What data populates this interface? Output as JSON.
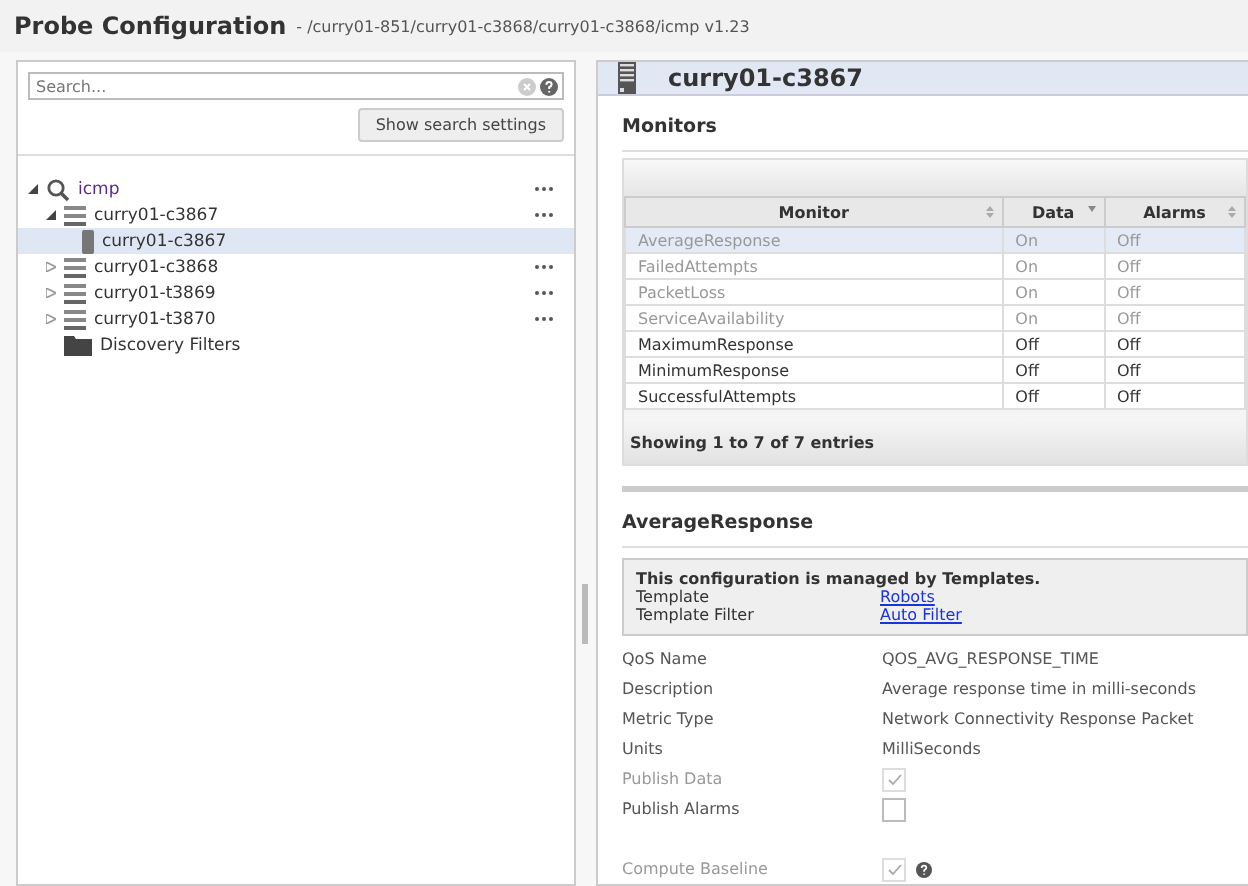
{
  "header": {
    "title": "Probe Configuration",
    "path": "- /curry01-851/curry01-c3868/curry01-c3868/icmp v1.23"
  },
  "search": {
    "placeholder": "Search...",
    "settings_button": "Show search settings"
  },
  "tree": [
    {
      "label": "icmp",
      "kind": "probe",
      "expanded": true,
      "selected": false,
      "menu": true,
      "children": [
        {
          "label": "curry01-c3867",
          "kind": "group",
          "expanded": true,
          "selected": false,
          "menu": true,
          "children": [
            {
              "label": "curry01-c3867",
              "kind": "device",
              "selected": true,
              "menu": false
            }
          ]
        },
        {
          "label": "curry01-c3868",
          "kind": "group",
          "expanded": false,
          "selected": false,
          "menu": true
        },
        {
          "label": "curry01-t3869",
          "kind": "group",
          "expanded": false,
          "selected": false,
          "menu": true
        },
        {
          "label": "curry01-t3870",
          "kind": "group",
          "expanded": false,
          "selected": false,
          "menu": true
        },
        {
          "label": "Discovery Filters",
          "kind": "folder",
          "selected": false,
          "menu": false
        }
      ]
    }
  ],
  "detail": {
    "title": "curry01-c3867",
    "section": "Monitors",
    "table": {
      "columns": [
        {
          "label": "Monitor",
          "sorted": false
        },
        {
          "label": "Data",
          "sorted": true
        },
        {
          "label": "Alarms",
          "sorted": false
        }
      ],
      "rows": [
        {
          "cells": [
            "AverageResponse",
            "On",
            "Off"
          ],
          "selected": true,
          "disabled": true
        },
        {
          "cells": [
            "FailedAttempts",
            "On",
            "Off"
          ],
          "selected": false,
          "disabled": true
        },
        {
          "cells": [
            "PacketLoss",
            "On",
            "Off"
          ],
          "selected": false,
          "disabled": true
        },
        {
          "cells": [
            "ServiceAvailability",
            "On",
            "Off"
          ],
          "selected": false,
          "disabled": true
        },
        {
          "cells": [
            "MaximumResponse",
            "Off",
            "Off"
          ],
          "selected": false,
          "disabled": false
        },
        {
          "cells": [
            "MinimumResponse",
            "Off",
            "Off"
          ],
          "selected": false,
          "disabled": false
        },
        {
          "cells": [
            "SuccessfulAttempts",
            "Off",
            "Off"
          ],
          "selected": false,
          "disabled": false
        }
      ],
      "footer": "Showing 1 to 7 of 7 entries"
    },
    "monitor_title": "AverageResponse",
    "template_box": {
      "heading": "This configuration is managed by Templates.",
      "rows": [
        {
          "label": "Template",
          "link": "Robots"
        },
        {
          "label": "Template Filter",
          "link": "Auto Filter"
        }
      ]
    },
    "fields": [
      {
        "label": "QoS Name",
        "kind": "text",
        "value": "QOS_AVG_RESPONSE_TIME"
      },
      {
        "label": "Description",
        "kind": "text",
        "value": "Average response time in milli-seconds"
      },
      {
        "label": "Metric Type",
        "kind": "text",
        "value": "Network Connectivity Response Packet"
      },
      {
        "label": "Units",
        "kind": "text",
        "value": "MilliSeconds"
      },
      {
        "label": "Publish Data",
        "kind": "checkbox",
        "checked": true,
        "disabled": true,
        "help": false
      },
      {
        "label": "Publish Alarms",
        "kind": "checkbox",
        "checked": false,
        "disabled": false,
        "help": false
      },
      {
        "label": "Compute Baseline",
        "kind": "checkbox",
        "checked": true,
        "disabled": true,
        "help": true,
        "gap": true
      }
    ]
  }
}
